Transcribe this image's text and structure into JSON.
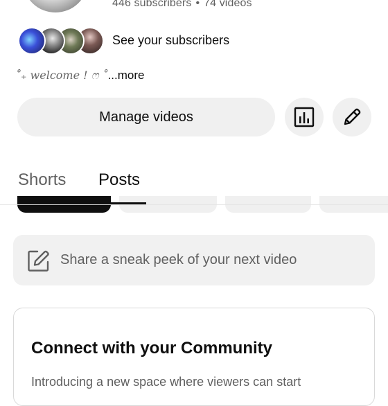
{
  "channel": {
    "subscribers": "446 subscribers",
    "separator": "•",
    "videos": "74 videos"
  },
  "subscribers_preview": {
    "label": "See your subscribers",
    "avatar_count": 4
  },
  "description": {
    "text": "˚₊ welcome ! ෆ ˚",
    "more": "...more"
  },
  "actions": {
    "manage_label": "Manage videos",
    "analytics_icon": "analytics-icon",
    "edit_icon": "pencil-icon"
  },
  "tabs": [
    {
      "label": "Shorts",
      "active": false
    },
    {
      "label": "Posts",
      "active": true
    }
  ],
  "composer": {
    "icon": "edit-square-icon",
    "placeholder": "Share a sneak peek of your next video"
  },
  "community_card": {
    "title": "Connect with your Community",
    "body": "Introducing a new space where viewers can start"
  },
  "colors": {
    "text_primary": "#0f0f0f",
    "text_secondary": "#606060",
    "button_bg": "#f0f0f0",
    "active_chip": "#0f0f0f"
  }
}
